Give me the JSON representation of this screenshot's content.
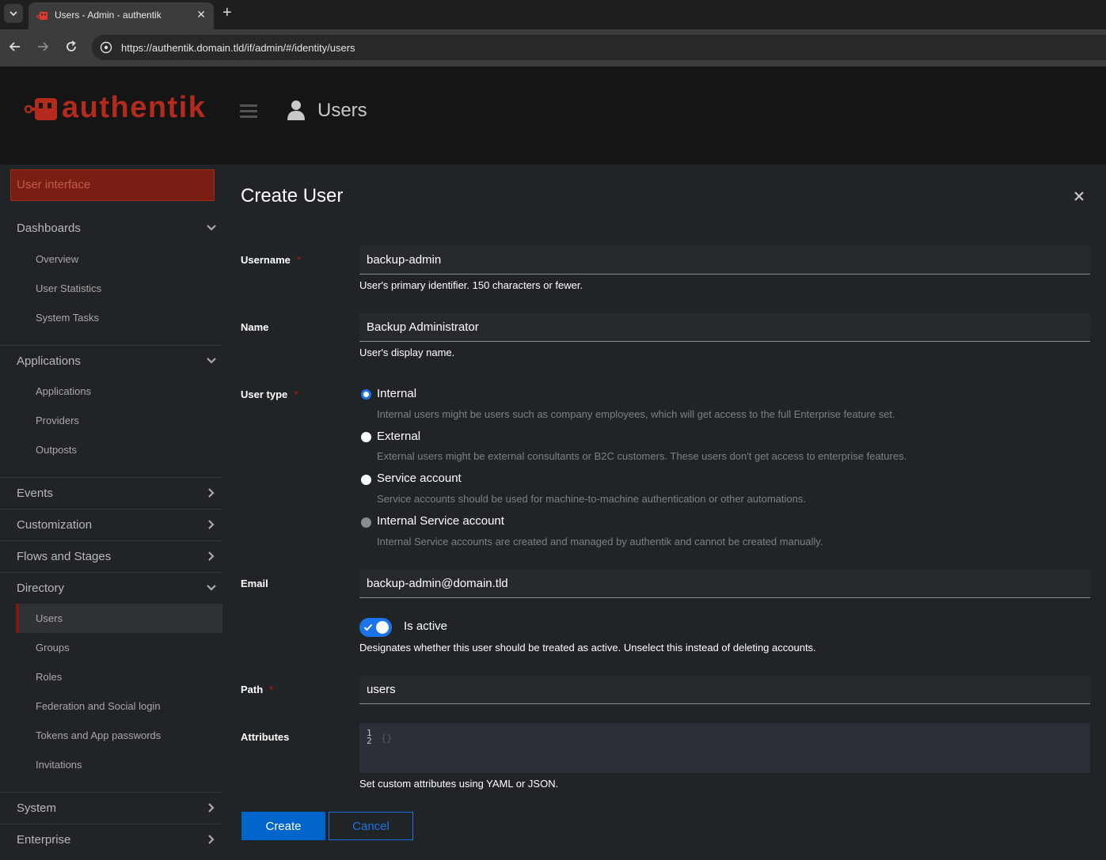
{
  "browser": {
    "tab_title": "Users - Admin - authentik",
    "new_tab_symbol": "+",
    "tab_close_symbol": "✕",
    "url": "https://authentik.domain.tld/if/admin/#/identity/users"
  },
  "header": {
    "logo_text": "authentik",
    "page_title": "Users",
    "brand_color": "#b22b1c"
  },
  "sidebar": {
    "user_interface_label": "User interface",
    "groups": [
      {
        "label": "Dashboards",
        "expanded": true,
        "items": [
          "Overview",
          "User Statistics",
          "System Tasks"
        ]
      },
      {
        "label": "Applications",
        "expanded": true,
        "items": [
          "Applications",
          "Providers",
          "Outposts"
        ]
      },
      {
        "label": "Events",
        "expanded": false
      },
      {
        "label": "Customization",
        "expanded": false
      },
      {
        "label": "Flows and Stages",
        "expanded": false
      },
      {
        "label": "Directory",
        "expanded": true,
        "items": [
          "Users",
          "Groups",
          "Roles",
          "Federation and Social login",
          "Tokens and App passwords",
          "Invitations"
        ],
        "active_item": "Users"
      },
      {
        "label": "System",
        "expanded": false
      },
      {
        "label": "Enterprise",
        "expanded": false
      }
    ]
  },
  "modal": {
    "title": "Create User",
    "username": {
      "label": "Username",
      "required_marker": "*",
      "value": "backup-admin",
      "helper": "User's primary identifier. 150 characters or fewer."
    },
    "name": {
      "label": "Name",
      "value": "Backup Administrator",
      "helper": "User's display name."
    },
    "user_type": {
      "label": "User type",
      "required_marker": "*",
      "options": [
        {
          "label": "Internal",
          "description": "Internal users might be users such as company employees, which will get access to the full Enterprise feature set.",
          "checked": true,
          "disabled": false
        },
        {
          "label": "External",
          "description": "External users might be external consultants or B2C customers. These users don't get access to enterprise features.",
          "checked": false,
          "disabled": false
        },
        {
          "label": "Service account",
          "description": "Service accounts should be used for machine-to-machine authentication or other automations.",
          "checked": false,
          "disabled": false
        },
        {
          "label": "Internal Service account",
          "description": "Internal Service accounts are created and managed by authentik and cannot be created manually.",
          "checked": false,
          "disabled": true
        }
      ]
    },
    "email": {
      "label": "Email",
      "value": "backup-admin@domain.tld"
    },
    "is_active": {
      "label": "Is active",
      "checked": true,
      "helper": "Designates whether this user should be treated as active. Unselect this instead of deleting accounts."
    },
    "path": {
      "label": "Path",
      "required_marker": "*",
      "value": "users"
    },
    "attributes": {
      "label": "Attributes",
      "line_numbers": [
        "1",
        "2"
      ],
      "code": "{}",
      "helper": "Set custom attributes using YAML or JSON."
    },
    "buttons": {
      "create": "Create",
      "cancel": "Cancel"
    },
    "accent_color": "#0066cc"
  }
}
